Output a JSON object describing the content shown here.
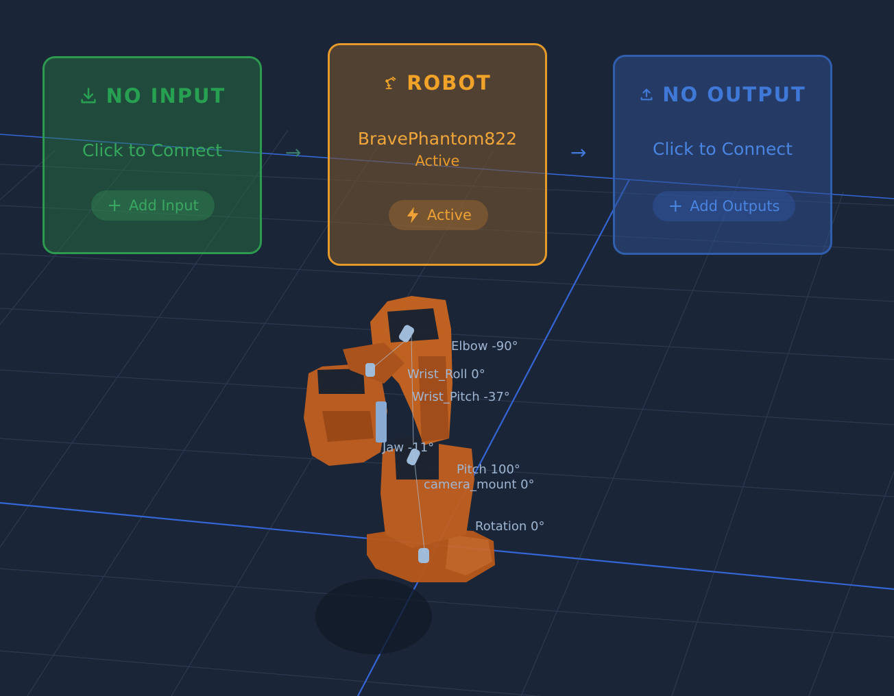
{
  "input_card": {
    "title": "NO INPUT",
    "subtitle": "Click to Connect",
    "button_label": "Add Input",
    "icon": "download-icon",
    "color": "#2d9a4f"
  },
  "robot_card": {
    "title": "ROBOT",
    "name": "BravePhantom822",
    "status": "Active",
    "button_label": "Active",
    "icon": "robot-arm-icon",
    "button_icon": "lightning-icon",
    "color": "#e59a2a"
  },
  "output_card": {
    "title": "NO OUTPUT",
    "subtitle": "Click to Connect",
    "button_label": "Add Outputs",
    "icon": "upload-icon",
    "color": "#2f5fae"
  },
  "connectors": [
    "→",
    "→"
  ],
  "joints": {
    "elbow": "Elbow -90°",
    "wrist_roll": "Wrist_Roll 0°",
    "wrist_pitch": "Wrist_Pitch -37°",
    "jaw": "Jaw -11°",
    "pitch": "Pitch 100°",
    "camera_mount": "camera_mount 0°",
    "rotation": "Rotation 0°"
  }
}
